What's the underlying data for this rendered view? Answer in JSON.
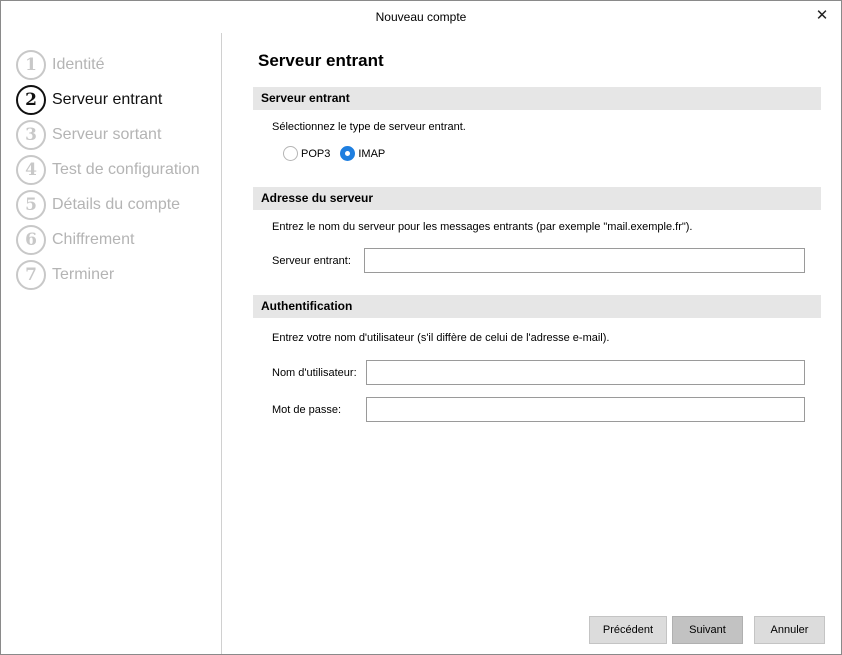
{
  "window": {
    "title": "Nouveau compte"
  },
  "steps": [
    {
      "num": "1",
      "label": "Identité"
    },
    {
      "num": "2",
      "label": "Serveur entrant"
    },
    {
      "num": "3",
      "label": "Serveur sortant"
    },
    {
      "num": "4",
      "label": "Test de configuration"
    },
    {
      "num": "5",
      "label": "Détails du compte"
    },
    {
      "num": "6",
      "label": "Chiffrement"
    },
    {
      "num": "7",
      "label": "Terminer"
    }
  ],
  "page": {
    "title": "Serveur entrant"
  },
  "incoming": {
    "header": "Serveur entrant",
    "instruction": "Sélectionnez le type de serveur entrant.",
    "options": [
      {
        "label": "POP3",
        "checked": false
      },
      {
        "label": "IMAP",
        "checked": true
      }
    ]
  },
  "server": {
    "header": "Adresse du serveur",
    "instruction": "Entrez le nom du serveur pour les messages entrants (par exemple \"mail.exemple.fr\").",
    "field_label": "Serveur entrant:",
    "field_value": ""
  },
  "auth": {
    "header": "Authentification",
    "instruction": "Entrez votre nom d'utilisateur (s'il diffère de celui de l'adresse e-mail).",
    "username_label": "Nom d'utilisateur:",
    "username_value": "",
    "password_label": "Mot de passe:",
    "password_value": ""
  },
  "buttons": {
    "previous": "Précédent",
    "next": "Suivant",
    "cancel": "Annuler"
  },
  "colors": {
    "accent": "#1f7fe0",
    "section_bg": "#e6e6e6",
    "inactive_step": "#b4b4b4"
  }
}
